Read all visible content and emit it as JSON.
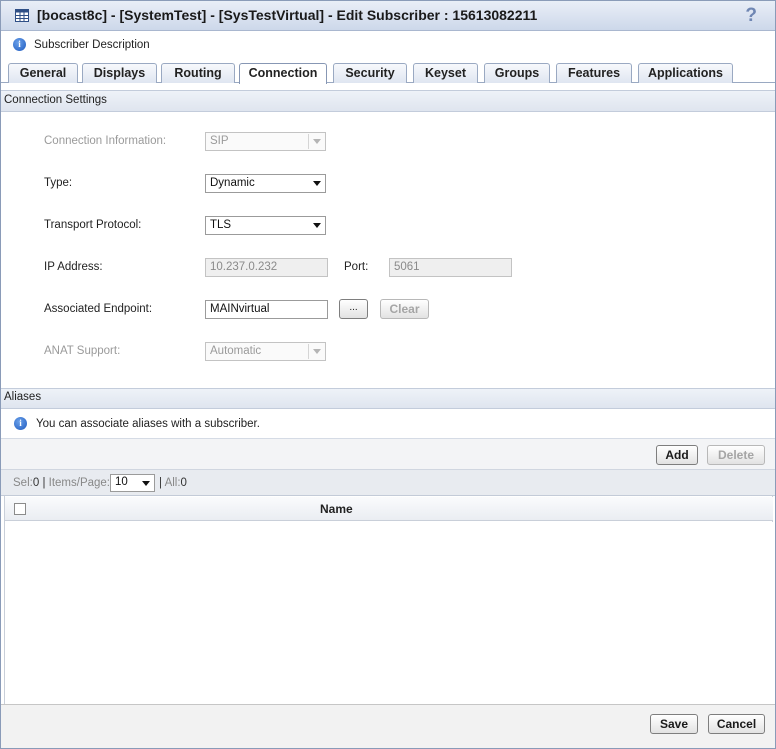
{
  "window": {
    "title": "[bocast8c] - [SystemTest] - [SysTestVirtual] - Edit Subscriber : 15613082211",
    "help_glyph": "?"
  },
  "description": {
    "label": "Subscriber Description"
  },
  "tabs": [
    {
      "label": "General",
      "active": false
    },
    {
      "label": "Displays",
      "active": false
    },
    {
      "label": "Routing",
      "active": false
    },
    {
      "label": "Connection",
      "active": true
    },
    {
      "label": "Security",
      "active": false
    },
    {
      "label": "Keyset",
      "active": false
    },
    {
      "label": "Groups",
      "active": false
    },
    {
      "label": "Features",
      "active": false
    },
    {
      "label": "Applications",
      "active": false
    }
  ],
  "connection_settings": {
    "header": "Connection Settings",
    "connection_information": {
      "label": "Connection Information:",
      "value": "SIP",
      "enabled": false
    },
    "type": {
      "label": "Type:",
      "value": "Dynamic"
    },
    "transport_protocol": {
      "label": "Transport Protocol:",
      "value": "TLS"
    },
    "ip_address": {
      "label": "IP Address:",
      "value": "10.237.0.232"
    },
    "port": {
      "label": "Port:",
      "value": "5061"
    },
    "associated_endpoint": {
      "label": "Associated Endpoint:",
      "value": "MAINvirtual",
      "browse_label": "...",
      "clear_label": "Clear"
    },
    "anat_support": {
      "label": "ANAT Support:",
      "value": "Automatic",
      "enabled": false
    }
  },
  "aliases": {
    "header": "Aliases",
    "info_text": "You can associate aliases with a subscriber.",
    "add_label": "Add",
    "delete_label": "Delete",
    "paging": {
      "sel_label": "Sel:",
      "sel_value": "0",
      "sep1": "|",
      "items_per_page_label": "Items/Page:",
      "items_per_page_value": "10",
      "sep2": "|",
      "all_label": "All:",
      "all_value": "0"
    },
    "table": {
      "columns": [
        "Name"
      ],
      "rows": []
    }
  },
  "footer": {
    "save_label": "Save",
    "cancel_label": "Cancel"
  },
  "colors": {
    "title_bar": "#cdd8ea",
    "section_header": "#dfe5ef",
    "info_icon": "#1f5bbf"
  },
  "icons": {
    "title": "grid-window-icon",
    "help": "help-question-icon",
    "info": "info-icon",
    "dropdown": "chevron-down-icon"
  }
}
